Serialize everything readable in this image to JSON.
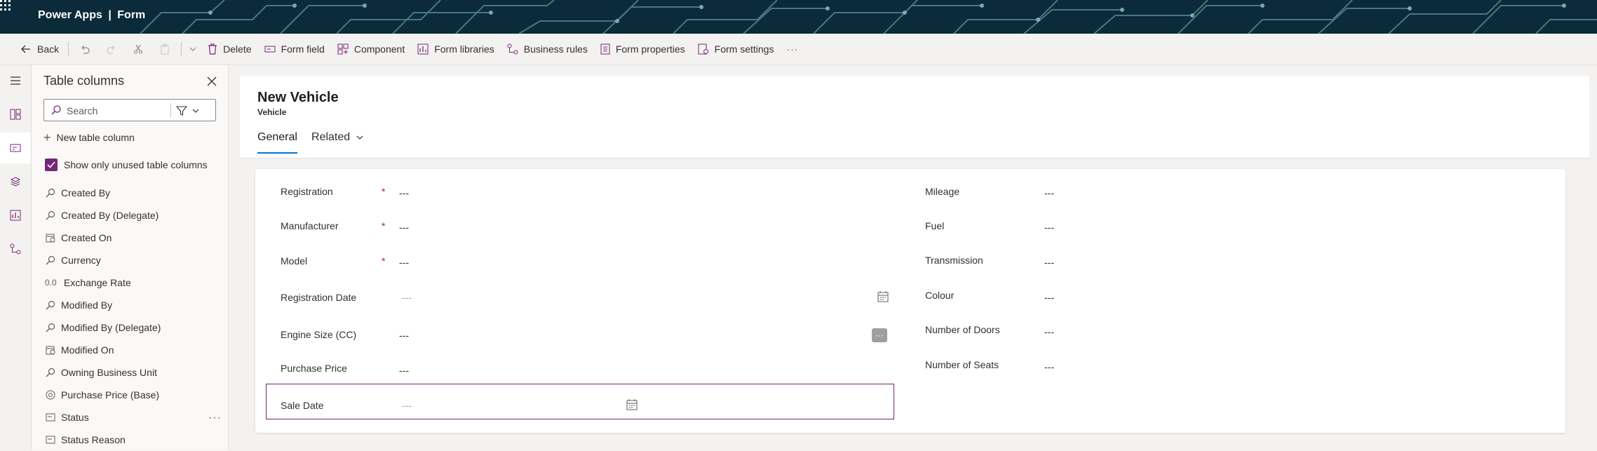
{
  "header": {
    "app_name": "Power Apps",
    "separator": "|",
    "page": "Form",
    "banner_color": "#0b2a3a"
  },
  "command_bar": {
    "back": "Back",
    "delete": "Delete",
    "form_field": "Form field",
    "component": "Component",
    "form_libraries": "Form libraries",
    "business_rules": "Business rules",
    "form_properties": "Form properties",
    "form_settings": "Form settings",
    "more": "···",
    "icons": [
      "back-arrow-icon",
      "undo-icon",
      "redo-icon",
      "cut-icon",
      "paste-icon",
      "chevron-down-icon",
      "delete-icon",
      "form-field-icon",
      "component-icon",
      "form-libraries-icon",
      "business-rules-icon",
      "form-properties-icon",
      "form-settings-icon",
      "more-icon"
    ]
  },
  "left_rail": {
    "icons": [
      "hamburger-icon",
      "components-icon",
      "table-columns-icon",
      "tree-view-icon",
      "form-libraries-icon",
      "business-rules-icon"
    ],
    "active_index": 2
  },
  "table_columns_pane": {
    "title": "Table columns",
    "search_placeholder": "Search",
    "new_column": "New table column",
    "show_unused": "Show only unused table columns",
    "show_unused_checked": true,
    "accent_color": "#742774",
    "columns": [
      {
        "label": "Created By",
        "icon": "lookup-icon",
        "glyph": ""
      },
      {
        "label": "Created By (Delegate)",
        "icon": "lookup-icon",
        "glyph": ""
      },
      {
        "label": "Created On",
        "icon": "date-time-icon",
        "glyph": ""
      },
      {
        "label": "Currency",
        "icon": "lookup-icon",
        "glyph": ""
      },
      {
        "label": "Exchange Rate",
        "icon": "decimal-icon",
        "glyph": "0.0"
      },
      {
        "label": "Modified By",
        "icon": "lookup-icon",
        "glyph": ""
      },
      {
        "label": "Modified By (Delegate)",
        "icon": "lookup-icon",
        "glyph": ""
      },
      {
        "label": "Modified On",
        "icon": "date-time-icon",
        "glyph": ""
      },
      {
        "label": "Owning Business Unit",
        "icon": "lookup-icon",
        "glyph": ""
      },
      {
        "label": "Purchase Price (Base)",
        "icon": "currency-icon",
        "glyph": ""
      },
      {
        "label": "Status",
        "icon": "choice-icon",
        "glyph": "",
        "more": "···"
      },
      {
        "label": "Status Reason",
        "icon": "choice-icon",
        "glyph": ""
      }
    ]
  },
  "form": {
    "title": "New Vehicle",
    "entity": "Vehicle",
    "tabs": {
      "general": "General",
      "related": "Related"
    },
    "left_fields": [
      {
        "label": "Registration",
        "required": "*",
        "value": "---"
      },
      {
        "label": "Manufacturer",
        "required": "*",
        "value": "---"
      },
      {
        "label": "Model",
        "required": "*",
        "value": "---"
      },
      {
        "label": "Registration Date",
        "value": "---"
      },
      {
        "label": "Engine Size (CC)",
        "value": "---"
      },
      {
        "label": "Purchase Price",
        "value": "---"
      },
      {
        "label": "Sale Date",
        "value": "---"
      }
    ],
    "right_fields": [
      {
        "label": "Mileage",
        "value": "---"
      },
      {
        "label": "Fuel",
        "value": "---"
      },
      {
        "label": "Transmission",
        "value": "---"
      },
      {
        "label": "Colour",
        "value": "---"
      },
      {
        "label": "Number of Doors",
        "value": "---"
      },
      {
        "label": "Number of Seats",
        "value": "---"
      }
    ],
    "selected_field": "Sale Date",
    "tab_accent": "#0078d4"
  }
}
